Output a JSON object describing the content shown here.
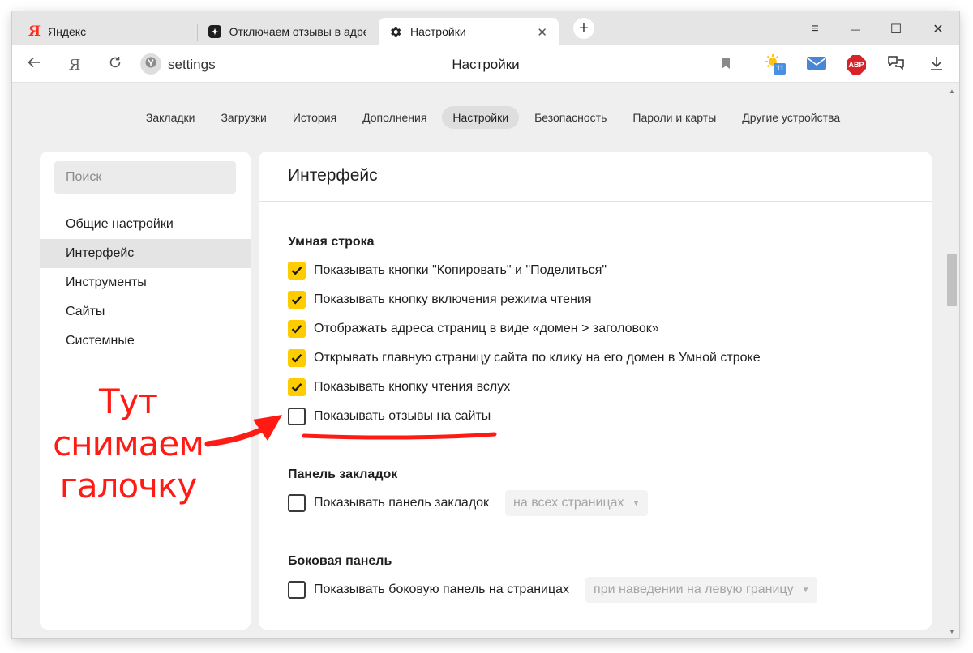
{
  "tabs": [
    {
      "label": "Яндекс",
      "icon": "yandex-logo-icon",
      "icon_text": "Я"
    },
    {
      "label": "Отключаем отзывы в адре",
      "icon": "zen-star-icon"
    },
    {
      "label": "Настройки",
      "icon": "gear-icon",
      "active": true
    }
  ],
  "window_controls": {
    "menu": "≡",
    "minimize": "—",
    "maximize": "☐",
    "close": "✕"
  },
  "address_bar": {
    "yandex_button": "Я",
    "address": "settings",
    "page_title": "Настройки",
    "calendar_badge": "11"
  },
  "top_nav": [
    {
      "label": "Закладки"
    },
    {
      "label": "Загрузки"
    },
    {
      "label": "История"
    },
    {
      "label": "Дополнения"
    },
    {
      "label": "Настройки",
      "active": true
    },
    {
      "label": "Безопасность"
    },
    {
      "label": "Пароли и карты"
    },
    {
      "label": "Другие устройства"
    }
  ],
  "sidebar": {
    "search_placeholder": "Поиск",
    "items": [
      {
        "label": "Общие настройки"
      },
      {
        "label": "Интерфейс",
        "active": true
      },
      {
        "label": "Инструменты"
      },
      {
        "label": "Сайты"
      },
      {
        "label": "Системные"
      }
    ]
  },
  "panel": {
    "title": "Интерфейс",
    "smart_bar": {
      "title": "Умная строка",
      "options": [
        {
          "label": "Показывать кнопки \"Копировать\" и \"Поделиться\"",
          "checked": true
        },
        {
          "label": "Показывать кнопку включения режима чтения",
          "checked": true
        },
        {
          "label": "Отображать адреса страниц в виде «домен > заголовок»",
          "checked": true
        },
        {
          "label": "Открывать главную страницу сайта по клику на его домен в Умной строке",
          "checked": true
        },
        {
          "label": "Показывать кнопку чтения вслух",
          "checked": true
        },
        {
          "label": "Показывать отзывы на сайты",
          "checked": false
        }
      ]
    },
    "bookmarks_bar": {
      "title": "Панель закладок",
      "option": {
        "label": "Показывать панель закладок",
        "checked": false
      },
      "select_value": "на всех страницах"
    },
    "side_panel": {
      "title": "Боковая панель",
      "option": {
        "label": "Показывать боковую панель на страницах",
        "checked": false
      },
      "select_value": "при наведении на левую границу"
    }
  },
  "annotation": {
    "line1": "Тут снимаем",
    "line2": "галочку",
    "color": "#ff1a14"
  },
  "colors": {
    "checkbox_accent": "#ffcc00",
    "yandex_red": "#ff2b1c",
    "abp_red": "#d7242b"
  },
  "extensions": {
    "abp_label": "ABP"
  }
}
